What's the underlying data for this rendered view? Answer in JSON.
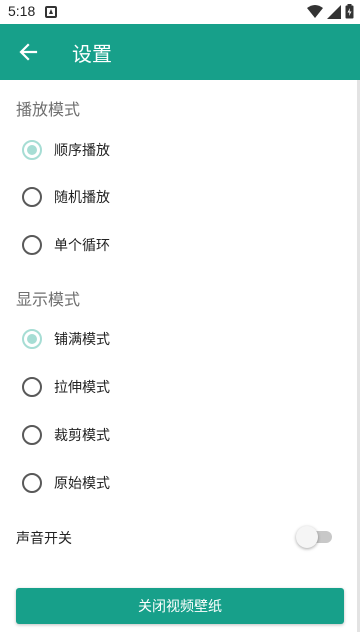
{
  "status_bar": {
    "time": "5:18"
  },
  "app_bar": {
    "title": "设置"
  },
  "play_mode": {
    "header": "播放模式",
    "options": [
      {
        "label": "顺序播放",
        "checked": true
      },
      {
        "label": "随机播放",
        "checked": false
      },
      {
        "label": "单个循环",
        "checked": false
      }
    ]
  },
  "display_mode": {
    "header": "显示模式",
    "options": [
      {
        "label": "铺满模式",
        "checked": true
      },
      {
        "label": "拉伸模式",
        "checked": false
      },
      {
        "label": "裁剪模式",
        "checked": false
      },
      {
        "label": "原始模式",
        "checked": false
      }
    ]
  },
  "sound": {
    "label": "声音开关",
    "enabled": false
  },
  "close_button": {
    "label": "关闭视频壁纸"
  },
  "colors": {
    "accent": "#17a08a",
    "radio_checked": "#a6ddd4"
  }
}
